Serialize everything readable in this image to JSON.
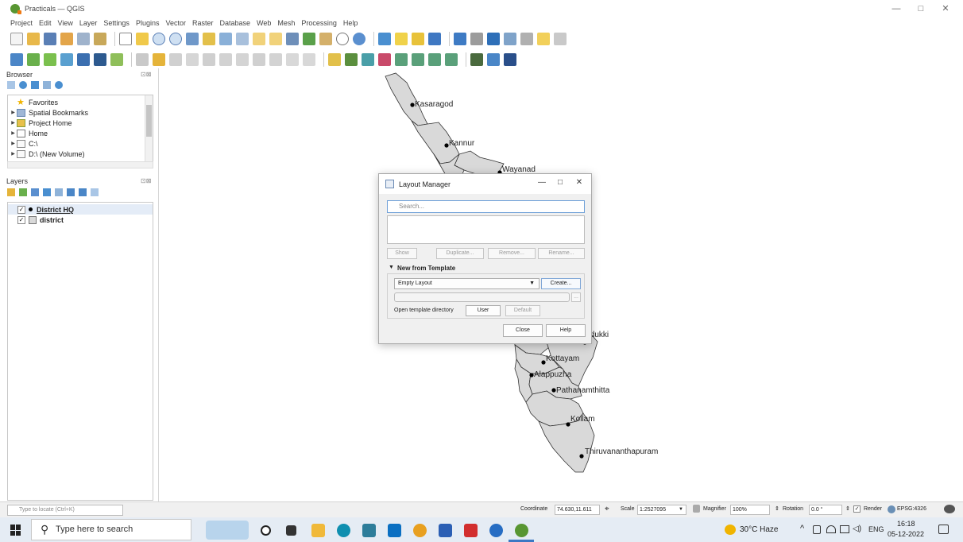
{
  "window": {
    "title": "Practicals — QGIS",
    "controls": [
      "—",
      "□",
      "✕"
    ]
  },
  "menu": [
    "Project",
    "Edit",
    "View",
    "Layer",
    "Settings",
    "Plugins",
    "Vector",
    "Raster",
    "Database",
    "Web",
    "Mesh",
    "Processing",
    "Help"
  ],
  "browser": {
    "title": "Browser",
    "items": [
      {
        "label": "Favorites",
        "icon": "star-icon",
        "expandable": false
      },
      {
        "label": "Spatial Bookmarks",
        "icon": "bookmark-icon",
        "expandable": true
      },
      {
        "label": "Project Home",
        "icon": "project-home-icon",
        "expandable": true
      },
      {
        "label": "Home",
        "icon": "home-folder-icon",
        "expandable": true
      },
      {
        "label": "C:\\",
        "icon": "drive-icon",
        "expandable": true
      },
      {
        "label": "D:\\ (New Volume)",
        "icon": "drive-icon",
        "expandable": true
      }
    ]
  },
  "layers": {
    "title": "Layers",
    "items": [
      {
        "label": "District HQ",
        "checked": true,
        "selected": true
      },
      {
        "label": "district",
        "checked": true,
        "selected": false
      }
    ]
  },
  "map": {
    "fill_color": "#d9d9d9",
    "stroke_color": "#333333",
    "labels": [
      "Kasaragod",
      "Kannur",
      "Wayanad",
      "Idukki",
      "Kottayam",
      "Alappuzha",
      "Pathanamthitta",
      "Kollam",
      "Thiruvananthapuram"
    ]
  },
  "dialog": {
    "title": "Layout Manager",
    "search_placeholder": "Search...",
    "buttons": {
      "show": "Show",
      "duplicate": "Duplicate...",
      "remove": "Remove...",
      "rename": "Rename..."
    },
    "template_header": "New from Template",
    "template_value": "Empty Layout",
    "create": "Create...",
    "browse": "...",
    "open_dir_label": "Open template directory",
    "user": "User",
    "default": "Default",
    "close": "Close",
    "help": "Help"
  },
  "statusbar": {
    "locate_placeholder": "Type to locate (Ctrl+K)",
    "coordinate_label": "Coordinate",
    "coordinate_value": "74.630,11.611",
    "scale_label": "Scale",
    "scale_value": "1:2527095",
    "magnifier_label": "Magnifier",
    "magnifier_value": "100%",
    "rotation_label": "Rotation",
    "rotation_value": "0.0 °",
    "render_label": "Render",
    "crs": "EPSG:4326"
  },
  "taskbar": {
    "search_placeholder": "Type here to search",
    "weather": "30°C  Haze",
    "language": "ENG",
    "time": "16:18",
    "date": "05-12-2022"
  }
}
